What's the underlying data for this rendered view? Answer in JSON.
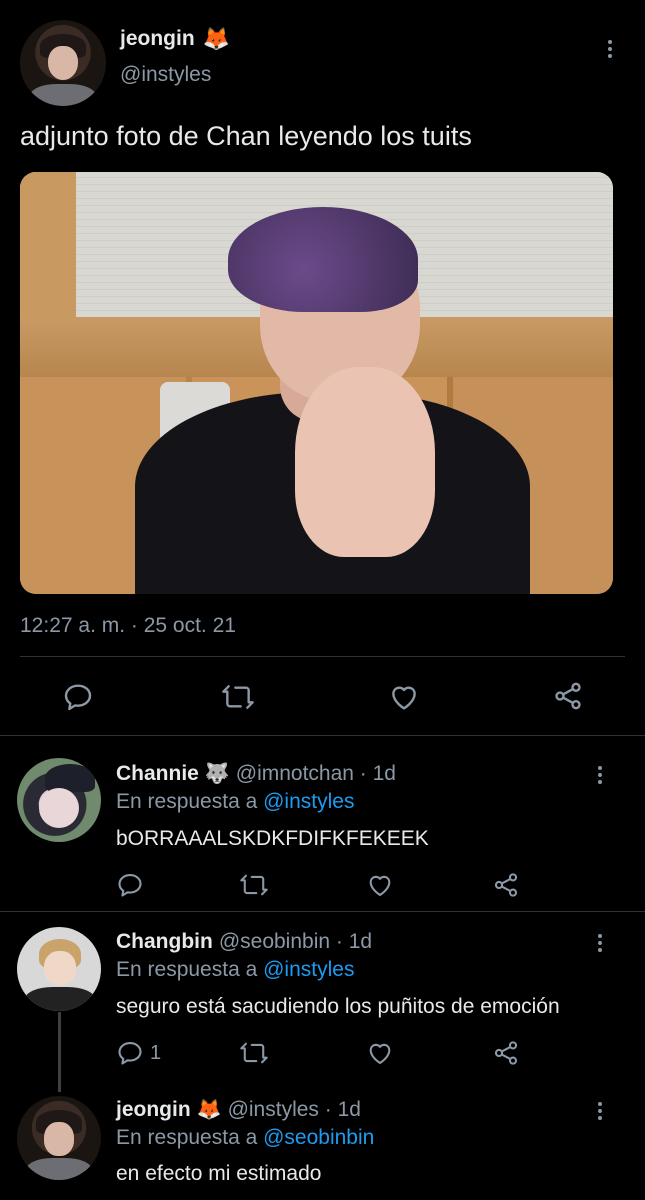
{
  "main_tweet": {
    "display_name": "jeongin",
    "emoji": "🦊",
    "handle": "@instyles",
    "text": "adjunto foto de Chan leyendo los tuits",
    "timestamp": "12:27 a. m. · 25 oct. 21",
    "media_alt": "photo of a person with purple hair laughing behind their hands",
    "actions": {
      "reply_icon": "reply-icon",
      "retweet_icon": "retweet-icon",
      "like_icon": "like-icon",
      "share_icon": "share-icon"
    }
  },
  "replies": [
    {
      "display_name": "Channie",
      "emoji": "🐺",
      "handle": "@imnotchan · 1d",
      "replying_prefix": "En respuesta a",
      "replying_to": "@instyles",
      "text": "bORRAAALSKDKFDIFKFEKEEK",
      "reply_count": ""
    },
    {
      "display_name": "Changbin",
      "emoji": "",
      "handle": "@seobinbin · 1d",
      "replying_prefix": "En respuesta a",
      "replying_to": "@instyles",
      "text": "seguro está sacudiendo los puñitos de emoción",
      "reply_count": "1"
    },
    {
      "display_name": "jeongin",
      "emoji": "🦊",
      "handle": "@instyles · 1d",
      "replying_prefix": "En respuesta a",
      "replying_to": "@seobinbin",
      "text": "en efecto mi estimado"
    }
  ],
  "colors": {
    "background": "#000000",
    "primary_text": "#e7e9ea",
    "secondary_text": "#8b98a5",
    "link": "#1d9bf0",
    "divider": "#2f3336"
  }
}
